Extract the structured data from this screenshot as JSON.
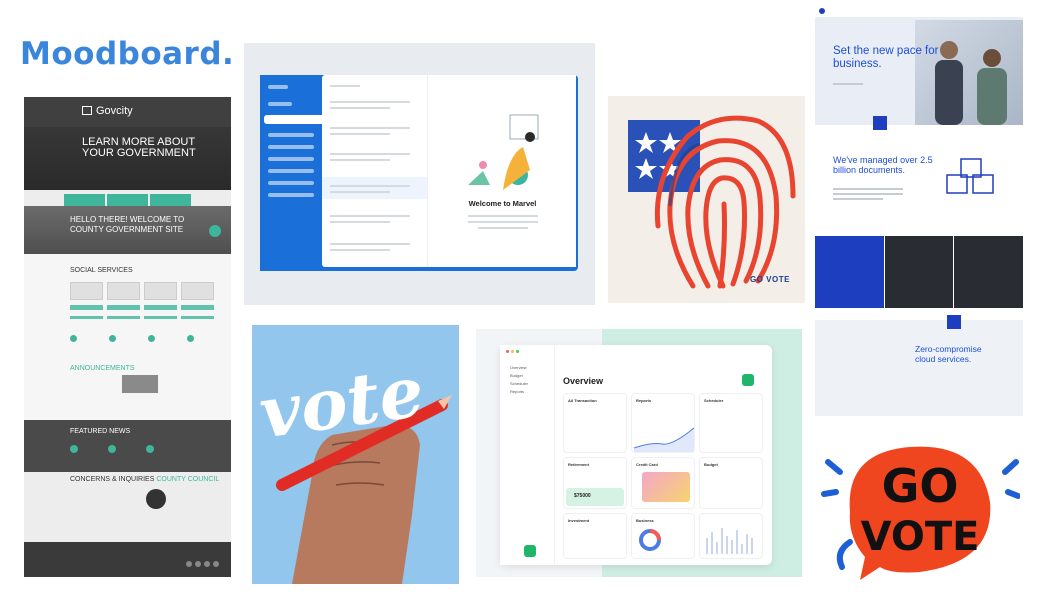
{
  "title": "Moodboard.",
  "govcity": {
    "logo": "Govcity",
    "hero": "LEARN MORE ABOUT YOUR GOVERNMENT",
    "hello": "HELLO THERE! WELCOME TO COUNTY GOVERNMENT SITE",
    "social": "SOCIAL SERVICES",
    "announcements": "ANNOUNCEMENTS",
    "featured": "FEATURED NEWS",
    "concerns": "CONCERNS & INQUIRIES",
    "council": "COUNTY COUNCIL"
  },
  "marvel": {
    "welcome": "Welcome to Marvel"
  },
  "fingerprint": {
    "text": "GO VOTE"
  },
  "business": {
    "headline": "Set the new pace for business.",
    "documents": "We've managed over 2.5 billion documents.",
    "cloud": "Zero-compromise cloud services."
  },
  "vote_poster": {
    "word": "vote"
  },
  "dashboard": {
    "overview": "Overview",
    "nav": [
      "Overview",
      "Budget",
      "Scheduler",
      "Reports"
    ],
    "cards": [
      "All Transaction",
      "Reports",
      "Scheduler",
      "Retirement",
      "Credit Card",
      "Budget",
      "Investment",
      "Business"
    ],
    "retirement_value": "$75000"
  },
  "go_vote": {
    "line1": "GO",
    "line2": "VOTE"
  },
  "colors": {
    "title": "#3b86dd",
    "teal": "#3fb69c",
    "marvel": "#1b6fd8",
    "flag_red": "#e8442f",
    "flag_blue": "#1c3f8f",
    "go_vote_orange": "#f0461f"
  }
}
